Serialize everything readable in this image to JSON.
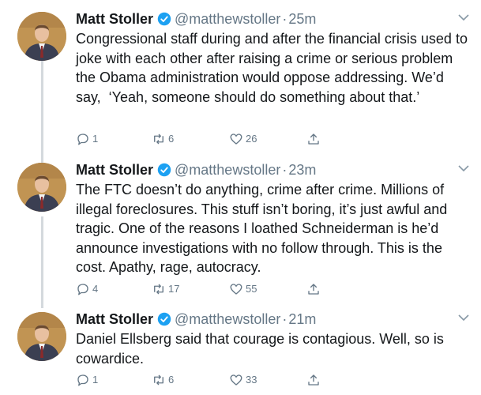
{
  "tweets": [
    {
      "name": "Matt Stoller",
      "handle": "@matthewstoller",
      "time": "25m",
      "text": "Congressional staff during and after the financial crisis used to joke with each other after raising a crime or serious problem the Obama administration would oppose addressing. We’d say,  ‘Yeah, someone should do something about that.’",
      "replies": "1",
      "retweets": "6",
      "likes": "26"
    },
    {
      "name": "Matt Stoller",
      "handle": "@matthewstoller",
      "time": "23m",
      "text": "The FTC doesn’t do anything, crime after crime. Millions of illegal foreclosures. This stuff isn’t boring, it’s just awful and tragic. One of the reasons I loathed Schneiderman is he’d announce investigations with no follow through. This is the cost. Apathy, rage, autocracy.",
      "replies": "4",
      "retweets": "17",
      "likes": "55"
    },
    {
      "name": "Matt Stoller",
      "handle": "@matthewstoller",
      "time": "21m",
      "text": "Daniel Ellsberg said that courage is contagious. Well, so is cowardice.",
      "replies": "1",
      "retweets": "6",
      "likes": "33"
    }
  ],
  "colors": {
    "verified": "#1da1f2",
    "muted": "#657786",
    "thread_line": "#d4d9dd"
  },
  "icons": [
    "verified-badge-icon",
    "chevron-down-icon",
    "reply-icon",
    "retweet-icon",
    "like-icon",
    "share-icon"
  ]
}
